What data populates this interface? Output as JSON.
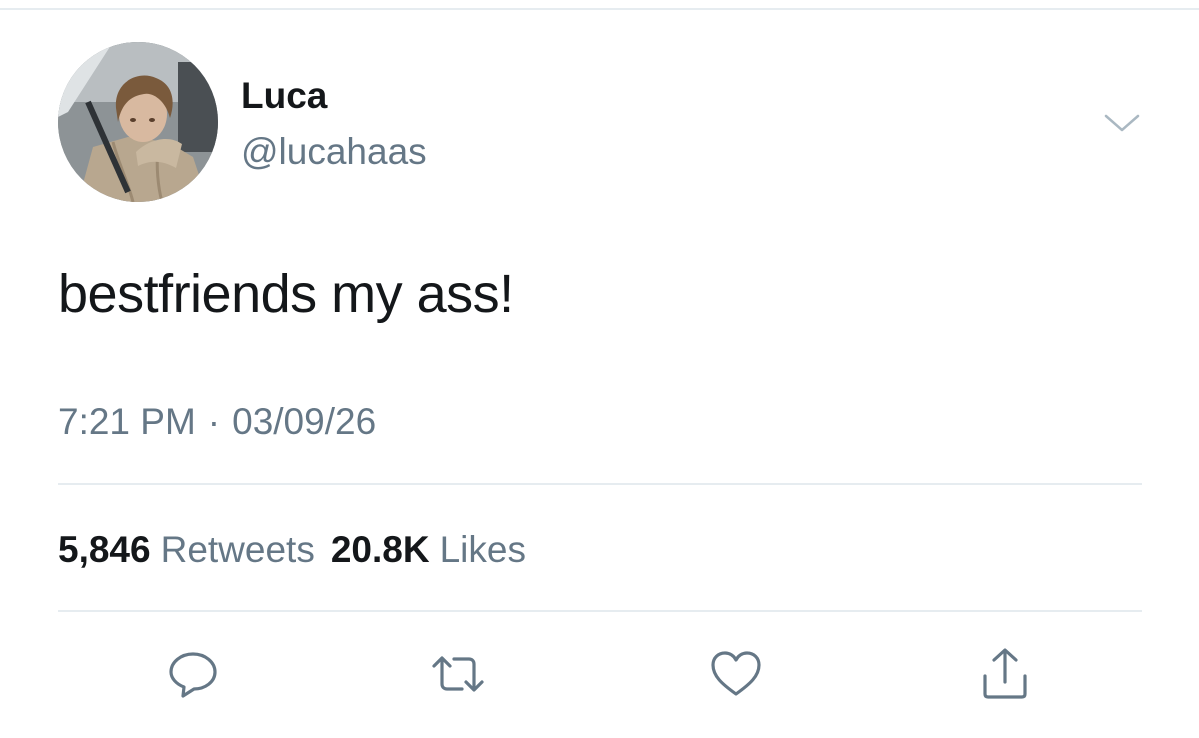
{
  "tweet": {
    "author": {
      "display_name": "Luca",
      "handle": "@lucahaas",
      "avatar": "profile-photo"
    },
    "text": "bestfriends my ass!",
    "time": "7:21 PM",
    "separator": "·",
    "date": "03/09/26",
    "stats": {
      "retweets_count": "5,846",
      "retweets_label": "Retweets",
      "likes_count": "20.8K",
      "likes_label": "Likes"
    },
    "actions": [
      {
        "name": "reply",
        "icon": "speech-bubble-icon"
      },
      {
        "name": "retweet",
        "icon": "retweet-arrows-icon"
      },
      {
        "name": "like",
        "icon": "heart-icon"
      },
      {
        "name": "share",
        "icon": "share-upload-icon"
      }
    ],
    "menu_icon": "chevron-down-icon"
  },
  "colors": {
    "text_primary": "#14171a",
    "text_secondary": "#657786",
    "divider": "#e6ecf0",
    "icon": "#657786"
  }
}
